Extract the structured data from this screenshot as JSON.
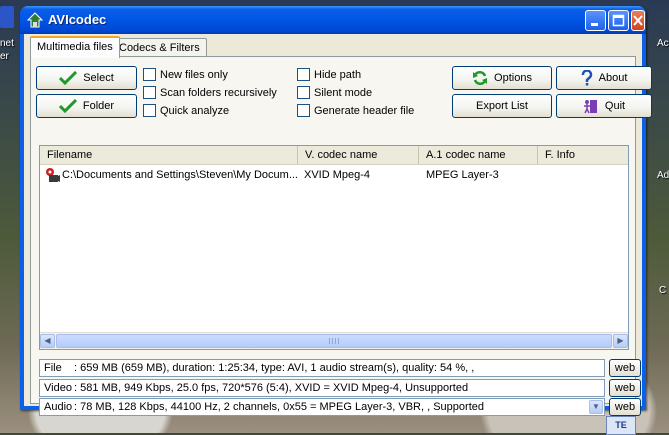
{
  "window": {
    "title": "AVIcodec"
  },
  "tabs": [
    {
      "label": "Multimedia files"
    },
    {
      "label": "Codecs & Filters"
    }
  ],
  "buttons": {
    "select": "Select",
    "folder": "Folder",
    "options": "Options",
    "about": "About",
    "export_list": "Export List",
    "quit": "Quit"
  },
  "checkboxes": {
    "new_files_only": "New files only",
    "scan_folders": "Scan folders recursively",
    "quick_analyze": "Quick analyze",
    "hide_path": "Hide path",
    "silent_mode": "Silent mode",
    "generate_header": "Generate header file"
  },
  "list": {
    "columns": [
      "Filename",
      "V. codec name",
      "A.1 codec name",
      "F. Info"
    ],
    "rows": [
      {
        "filename": "C:\\Documents and Settings\\Steven\\My Docum...",
        "vcodec": "XVID Mpeg-4",
        "acodec": "MPEG Layer-3",
        "finfo": ""
      }
    ]
  },
  "info": {
    "file": {
      "label": "File",
      "text": ":  659 MB (659 MB),  duration: 1:25:34,  type: AVI,  1 audio stream(s),  quality: 54 %, ,"
    },
    "video": {
      "label": "Video",
      "text": ": 581 MB,  949 Kbps,  25.0 fps,  720*576 (5:4),  XVID = XVID Mpeg-4,    Unsupported"
    },
    "audio": {
      "label": "Audio",
      "text": ": 78 MB,  128 Kbps,  44100 Hz,  2 channels,  0x55 = MPEG Layer-3,  VBR, ,   Supported"
    }
  },
  "web_label": "web",
  "desktop": {
    "left_labels": [
      "net",
      "er"
    ],
    "right_labels": [
      "Ac",
      "Ad",
      "C"
    ],
    "tray_label": "TE"
  }
}
